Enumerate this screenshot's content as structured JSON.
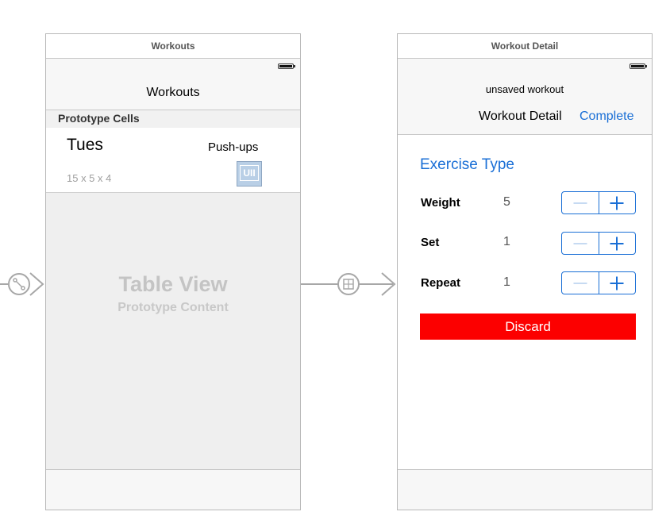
{
  "workouts_scene": {
    "scene_title": "Workouts",
    "nav_title": "Workouts",
    "section_header": "Prototype Cells",
    "cell": {
      "day": "Tues",
      "exercise": "Push-ups",
      "detail": "15 x 5 x 4",
      "image_placeholder": "UII"
    },
    "table_view_title": "Table View",
    "table_view_subtitle": "Prototype Content"
  },
  "detail_scene": {
    "scene_title": "Workout Detail",
    "nav_prompt": "unsaved workout",
    "nav_title": "Workout Detail",
    "complete_label": "Complete",
    "exercise_type": "Exercise Type",
    "rows": [
      {
        "label": "Weight",
        "value": "5"
      },
      {
        "label": "Set",
        "value": "1"
      },
      {
        "label": "Repeat",
        "value": "1"
      }
    ],
    "discard_label": "Discard"
  },
  "colors": {
    "tint": "#1a6fd6",
    "discard_red": "#fc0000",
    "segue_gray": "#a7a7a7"
  },
  "icons": {
    "entry_segue": "entry-point-arrow-icon",
    "relationship_segue": "relationship-segue-icon"
  }
}
